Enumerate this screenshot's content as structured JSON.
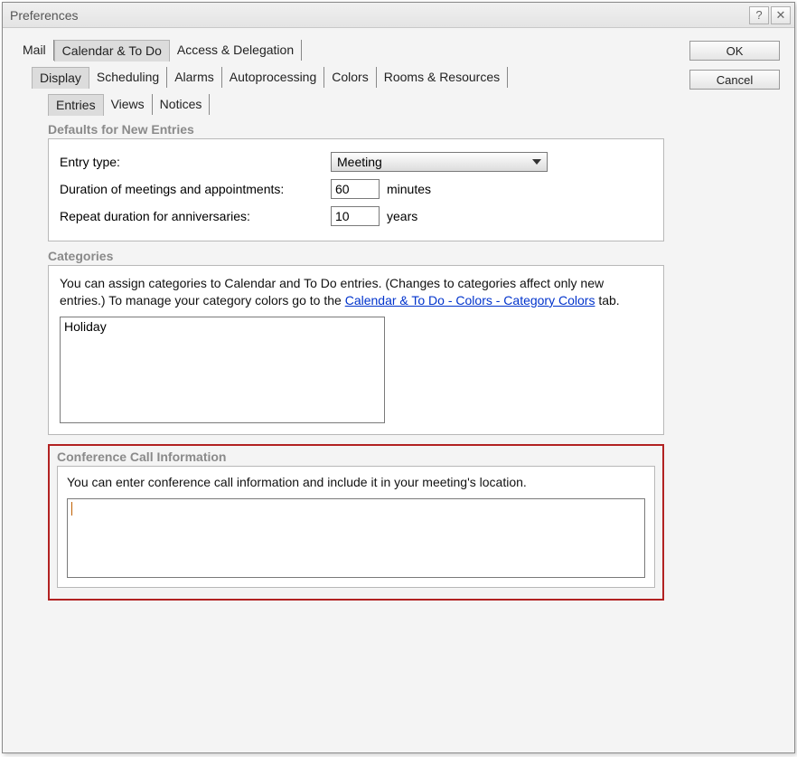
{
  "window": {
    "title": "Preferences",
    "help_glyph": "?",
    "close_glyph": "✕"
  },
  "buttons": {
    "ok": "OK",
    "cancel": "Cancel"
  },
  "tabs": {
    "level1": {
      "mail": "Mail",
      "calendar": "Calendar & To Do",
      "access": "Access & Delegation"
    },
    "level2": {
      "display": "Display",
      "scheduling": "Scheduling",
      "alarms": "Alarms",
      "autoprocessing": "Autoprocessing",
      "colors": "Colors",
      "rooms": "Rooms & Resources"
    },
    "level3": {
      "entries": "Entries",
      "views": "Views",
      "notices": "Notices"
    }
  },
  "defaults_section": {
    "heading": "Defaults for New Entries",
    "entry_type_label": "Entry type:",
    "entry_type_value": "Meeting",
    "duration_label": "Duration of meetings and appointments:",
    "duration_value": "60",
    "duration_unit": "minutes",
    "repeat_label": "Repeat duration for anniversaries:",
    "repeat_value": "10",
    "repeat_unit": "years"
  },
  "categories_section": {
    "heading": "Categories",
    "desc_before": "You can assign categories to Calendar and To Do entries.  (Changes to categories affect only new entries.) To manage your category colors go to the ",
    "desc_link": "Calendar & To Do - Colors - Category Colors",
    "desc_after": " tab.",
    "item0": "Holiday"
  },
  "conference_section": {
    "heading": "Conference Call Information",
    "desc": "You can enter conference call information and include it in your meeting's location."
  }
}
